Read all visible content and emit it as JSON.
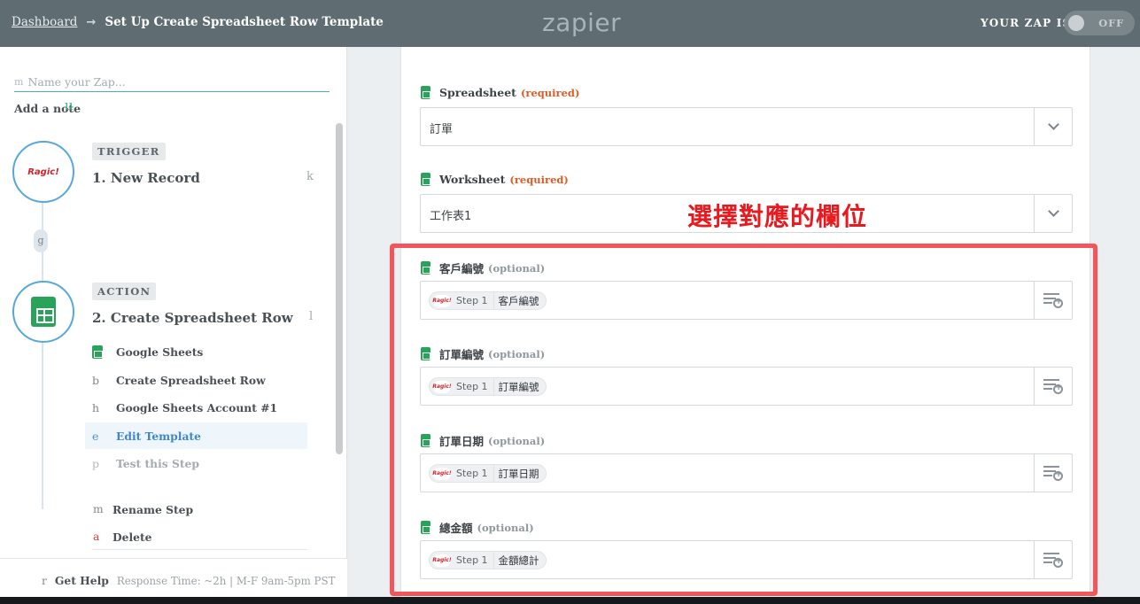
{
  "header": {
    "breadcrumb_link": "Dashboard",
    "breadcrumb_arrow": "→",
    "breadcrumb_title": "Set Up Create Spreadsheet Row Template",
    "logo": "zapier",
    "zap_is_label": "YOUR ZAP IS",
    "toggle_state": "OFF"
  },
  "sidebar": {
    "zap_name_key": "m",
    "zap_name_placeholder": "Name your Zap...",
    "add_note": "Add a note",
    "trigger": {
      "pill": "TRIGGER",
      "node_logo": "Ragic!",
      "shortcut_u": "u",
      "title": "1. New Record",
      "key": "k"
    },
    "connector_key": "g",
    "action": {
      "pill": "ACTION",
      "title": "2. Create Spreadsheet Row",
      "key": "l",
      "items": [
        {
          "key": "",
          "label": "Google Sheets"
        },
        {
          "key": "b",
          "label": "Create Spreadsheet Row"
        },
        {
          "key": "h",
          "label": "Google Sheets Account #1"
        },
        {
          "key": "e",
          "label": "Edit Template"
        },
        {
          "key": "p",
          "label": "Test this Step"
        }
      ],
      "extra": [
        {
          "key": "m",
          "label": "Rename Step"
        },
        {
          "key": "a",
          "label": "Delete"
        }
      ]
    },
    "help": {
      "key": "r",
      "label": "Get Help",
      "meta": "Response Time: ~2h | M-F 9am-5pm PST"
    }
  },
  "form": {
    "required_text": "(required)",
    "optional_text": "(optional)",
    "spreadsheet": {
      "label": "Spreadsheet",
      "value": "訂單"
    },
    "worksheet": {
      "label": "Worksheet",
      "value": "工作表1"
    },
    "annotation": "選擇對應的欄位",
    "mapped": [
      {
        "label": "客戶編號",
        "step": "Step 1",
        "value": "客戶編號"
      },
      {
        "label": "訂單編號",
        "step": "Step 1",
        "value": "訂單編號"
      },
      {
        "label": "訂單日期",
        "step": "Step 1",
        "value": "訂單日期"
      },
      {
        "label": "總金額",
        "step": "Step 1",
        "value": "金額總計"
      }
    ],
    "token_logo": "Ragic!"
  },
  "colors": {
    "header_bg": "#5f6c72",
    "sheets_green": "#2aa35a",
    "required": "#e05a23",
    "annotation_red": "#e8191f",
    "active_blue": "#3f88c5"
  }
}
